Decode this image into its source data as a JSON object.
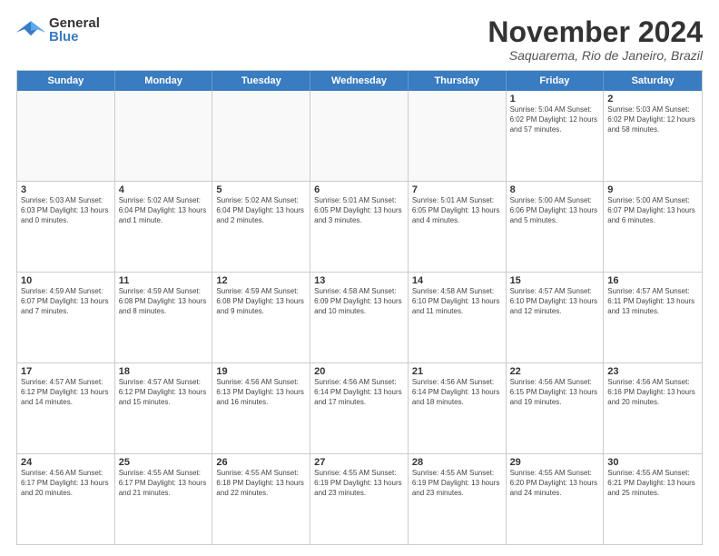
{
  "header": {
    "logo_general": "General",
    "logo_blue": "Blue",
    "month_title": "November 2024",
    "location": "Saquarema, Rio de Janeiro, Brazil"
  },
  "calendar": {
    "day_names": [
      "Sunday",
      "Monday",
      "Tuesday",
      "Wednesday",
      "Thursday",
      "Friday",
      "Saturday"
    ],
    "rows": [
      [
        {
          "date": "",
          "info": ""
        },
        {
          "date": "",
          "info": ""
        },
        {
          "date": "",
          "info": ""
        },
        {
          "date": "",
          "info": ""
        },
        {
          "date": "",
          "info": ""
        },
        {
          "date": "1",
          "info": "Sunrise: 5:04 AM\nSunset: 6:02 PM\nDaylight: 12 hours\nand 57 minutes."
        },
        {
          "date": "2",
          "info": "Sunrise: 5:03 AM\nSunset: 6:02 PM\nDaylight: 12 hours\nand 58 minutes."
        }
      ],
      [
        {
          "date": "3",
          "info": "Sunrise: 5:03 AM\nSunset: 6:03 PM\nDaylight: 13 hours\nand 0 minutes."
        },
        {
          "date": "4",
          "info": "Sunrise: 5:02 AM\nSunset: 6:04 PM\nDaylight: 13 hours\nand 1 minute."
        },
        {
          "date": "5",
          "info": "Sunrise: 5:02 AM\nSunset: 6:04 PM\nDaylight: 13 hours\nand 2 minutes."
        },
        {
          "date": "6",
          "info": "Sunrise: 5:01 AM\nSunset: 6:05 PM\nDaylight: 13 hours\nand 3 minutes."
        },
        {
          "date": "7",
          "info": "Sunrise: 5:01 AM\nSunset: 6:05 PM\nDaylight: 13 hours\nand 4 minutes."
        },
        {
          "date": "8",
          "info": "Sunrise: 5:00 AM\nSunset: 6:06 PM\nDaylight: 13 hours\nand 5 minutes."
        },
        {
          "date": "9",
          "info": "Sunrise: 5:00 AM\nSunset: 6:07 PM\nDaylight: 13 hours\nand 6 minutes."
        }
      ],
      [
        {
          "date": "10",
          "info": "Sunrise: 4:59 AM\nSunset: 6:07 PM\nDaylight: 13 hours\nand 7 minutes."
        },
        {
          "date": "11",
          "info": "Sunrise: 4:59 AM\nSunset: 6:08 PM\nDaylight: 13 hours\nand 8 minutes."
        },
        {
          "date": "12",
          "info": "Sunrise: 4:59 AM\nSunset: 6:08 PM\nDaylight: 13 hours\nand 9 minutes."
        },
        {
          "date": "13",
          "info": "Sunrise: 4:58 AM\nSunset: 6:09 PM\nDaylight: 13 hours\nand 10 minutes."
        },
        {
          "date": "14",
          "info": "Sunrise: 4:58 AM\nSunset: 6:10 PM\nDaylight: 13 hours\nand 11 minutes."
        },
        {
          "date": "15",
          "info": "Sunrise: 4:57 AM\nSunset: 6:10 PM\nDaylight: 13 hours\nand 12 minutes."
        },
        {
          "date": "16",
          "info": "Sunrise: 4:57 AM\nSunset: 6:11 PM\nDaylight: 13 hours\nand 13 minutes."
        }
      ],
      [
        {
          "date": "17",
          "info": "Sunrise: 4:57 AM\nSunset: 6:12 PM\nDaylight: 13 hours\nand 14 minutes."
        },
        {
          "date": "18",
          "info": "Sunrise: 4:57 AM\nSunset: 6:12 PM\nDaylight: 13 hours\nand 15 minutes."
        },
        {
          "date": "19",
          "info": "Sunrise: 4:56 AM\nSunset: 6:13 PM\nDaylight: 13 hours\nand 16 minutes."
        },
        {
          "date": "20",
          "info": "Sunrise: 4:56 AM\nSunset: 6:14 PM\nDaylight: 13 hours\nand 17 minutes."
        },
        {
          "date": "21",
          "info": "Sunrise: 4:56 AM\nSunset: 6:14 PM\nDaylight: 13 hours\nand 18 minutes."
        },
        {
          "date": "22",
          "info": "Sunrise: 4:56 AM\nSunset: 6:15 PM\nDaylight: 13 hours\nand 19 minutes."
        },
        {
          "date": "23",
          "info": "Sunrise: 4:56 AM\nSunset: 6:16 PM\nDaylight: 13 hours\nand 20 minutes."
        }
      ],
      [
        {
          "date": "24",
          "info": "Sunrise: 4:56 AM\nSunset: 6:17 PM\nDaylight: 13 hours\nand 20 minutes."
        },
        {
          "date": "25",
          "info": "Sunrise: 4:55 AM\nSunset: 6:17 PM\nDaylight: 13 hours\nand 21 minutes."
        },
        {
          "date": "26",
          "info": "Sunrise: 4:55 AM\nSunset: 6:18 PM\nDaylight: 13 hours\nand 22 minutes."
        },
        {
          "date": "27",
          "info": "Sunrise: 4:55 AM\nSunset: 6:19 PM\nDaylight: 13 hours\nand 23 minutes."
        },
        {
          "date": "28",
          "info": "Sunrise: 4:55 AM\nSunset: 6:19 PM\nDaylight: 13 hours\nand 23 minutes."
        },
        {
          "date": "29",
          "info": "Sunrise: 4:55 AM\nSunset: 6:20 PM\nDaylight: 13 hours\nand 24 minutes."
        },
        {
          "date": "30",
          "info": "Sunrise: 4:55 AM\nSunset: 6:21 PM\nDaylight: 13 hours\nand 25 minutes."
        }
      ]
    ]
  }
}
